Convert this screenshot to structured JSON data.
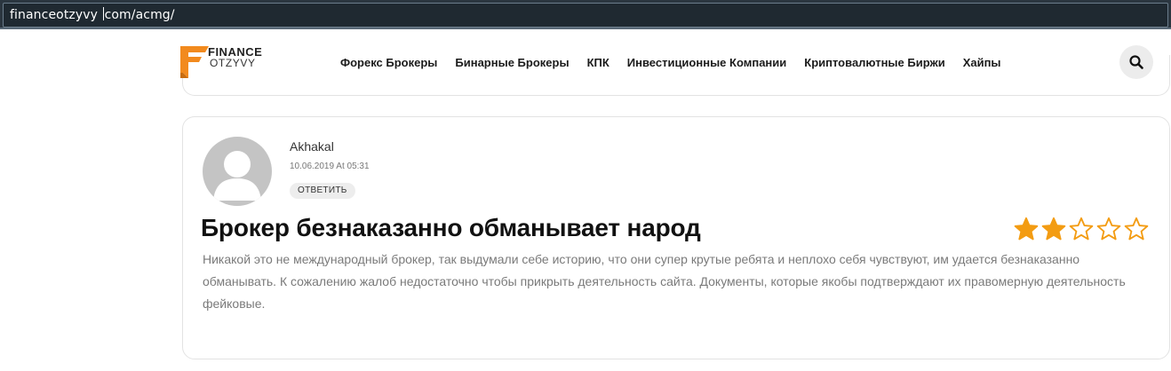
{
  "browser": {
    "url_before_caret": "financeotzyvy ",
    "url_after_caret": "com/acmg/"
  },
  "logo": {
    "line1": "FINANCE",
    "line2": "OTZYVY",
    "colors": {
      "orange": "#f28a1e",
      "dark": "#222222"
    }
  },
  "nav": {
    "items": [
      {
        "label": "Форекс Брокеры"
      },
      {
        "label": "Бинарные Брокеры"
      },
      {
        "label": "КПК"
      },
      {
        "label": "Инвестиционные Компании"
      },
      {
        "label": "Криптовалютные Биржи"
      },
      {
        "label": "Хайпы"
      }
    ],
    "search_icon": "search-icon"
  },
  "review": {
    "author": "Akhakal",
    "date": "10.06.2019 At 05:31",
    "reply_label": "ОТВЕТИТЬ",
    "title": "Брокер безнаказанно обманывает народ",
    "rating": 2,
    "rating_max": 5,
    "star_color": "#f39c12",
    "text": "Никакой это не международный брокер, так выдумали себе историю, что они супер крутые ребята и неплохо себя чувствуют, им удается безнаказанно обманывать. К сожалению жалоб недостаточно чтобы прикрыть деятельность сайта. Документы, которые якобы подтверждают их правомерную деятельность фейковые."
  }
}
